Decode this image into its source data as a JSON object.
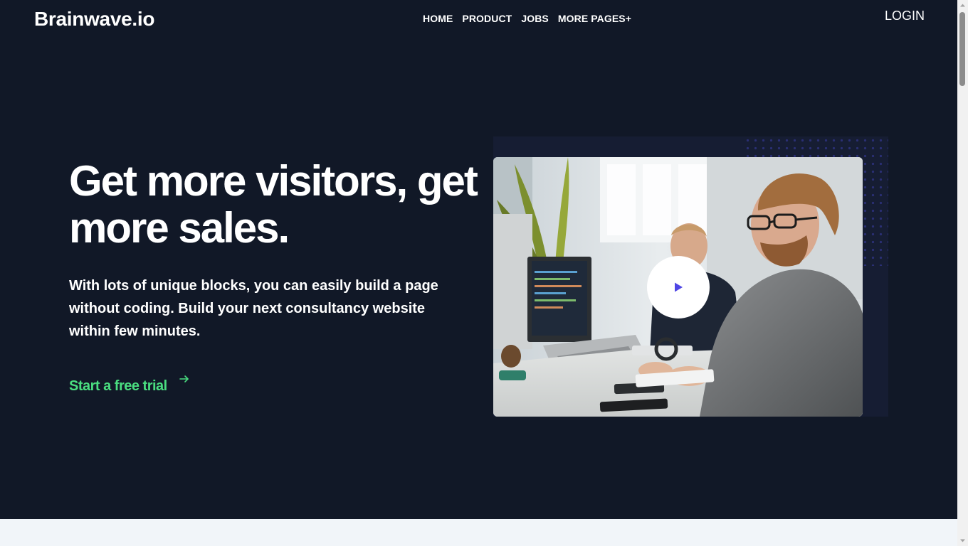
{
  "header": {
    "logo": "Brainwave.io",
    "nav": [
      "HOME",
      "PRODUCT",
      "JOBS",
      "MORE PAGES+"
    ],
    "login": "LOGIN"
  },
  "hero": {
    "headline": "Get more visitors, get more sales.",
    "subtext": "With lots of unique blocks, you can easily build a page without coding. Build your next consultancy website within few minutes.",
    "cta": "Start a free trial",
    "cta_icon": "arrow-right-icon",
    "media_icon": "play-icon"
  },
  "colors": {
    "background": "#111827",
    "accent_green": "#4ade80",
    "play_icon": "#4f46e5",
    "next_section": "#f1f5f9"
  }
}
